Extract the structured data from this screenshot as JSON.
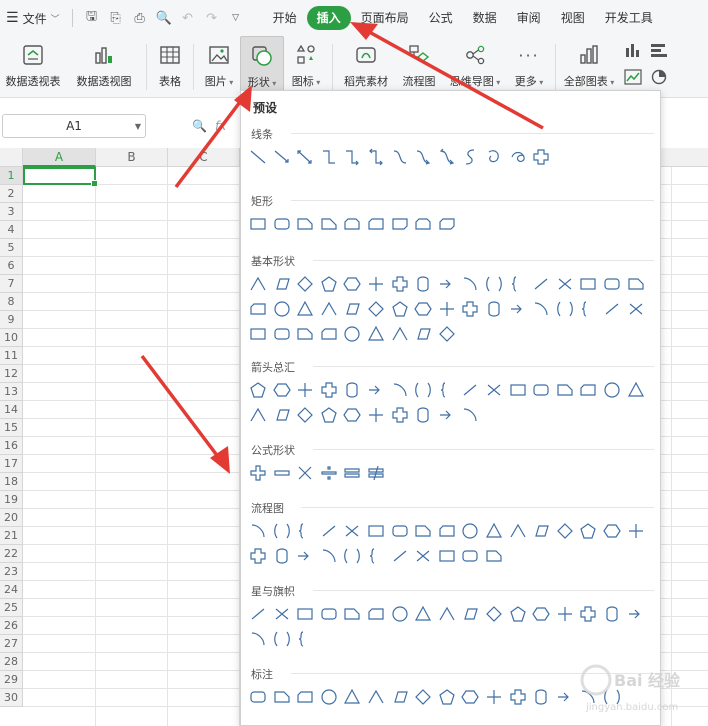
{
  "menubar": {
    "file_label": "文件",
    "tabs": [
      "开始",
      "插入",
      "页面布局",
      "公式",
      "数据",
      "审阅",
      "视图",
      "开发工具"
    ],
    "active_tab": "插入"
  },
  "ribbon": {
    "items": [
      {
        "label": "数据透视表",
        "icon": "pivot-table-icon"
      },
      {
        "label": "数据透视图",
        "icon": "pivot-chart-icon"
      },
      {
        "label": "表格",
        "icon": "table-icon"
      },
      {
        "label": "图片",
        "icon": "picture-icon"
      },
      {
        "label": "形状",
        "icon": "shapes-icon"
      },
      {
        "label": "图标",
        "icon": "icons-icon"
      },
      {
        "label": "稻壳素材",
        "icon": "docer-material-icon"
      },
      {
        "label": "流程图",
        "icon": "flowchart-icon"
      },
      {
        "label": "思维导图",
        "icon": "mindmap-icon"
      },
      {
        "label": "更多",
        "icon": "more-icon"
      },
      {
        "label": "全部图表",
        "icon": "all-charts-icon"
      }
    ]
  },
  "formula": {
    "cell_ref": "A1",
    "fx_label": "fx"
  },
  "grid": {
    "columns": [
      "A",
      "B",
      "C"
    ],
    "rows": [
      "1",
      "2",
      "3",
      "4",
      "5",
      "6",
      "7",
      "8",
      "9",
      "10",
      "11",
      "12",
      "13",
      "14",
      "15",
      "16",
      "17",
      "18",
      "19",
      "20",
      "21",
      "22",
      "23",
      "24",
      "25",
      "26",
      "27",
      "28",
      "29",
      "30"
    ]
  },
  "panel": {
    "title": "预设",
    "sections": [
      {
        "name": "线条"
      },
      {
        "name": "矩形"
      },
      {
        "name": "基本形状"
      },
      {
        "name": "箭头总汇"
      },
      {
        "name": "公式形状"
      },
      {
        "name": "流程图"
      },
      {
        "name": "星与旗帜"
      },
      {
        "name": "标注"
      }
    ]
  },
  "watermark": {
    "text": "Bai 经验",
    "sub": "jingyan.baidu.com"
  },
  "colors": {
    "accent": "#2c9f45",
    "shape_stroke": "#3f6fa5",
    "arrow": "#e33b34"
  }
}
